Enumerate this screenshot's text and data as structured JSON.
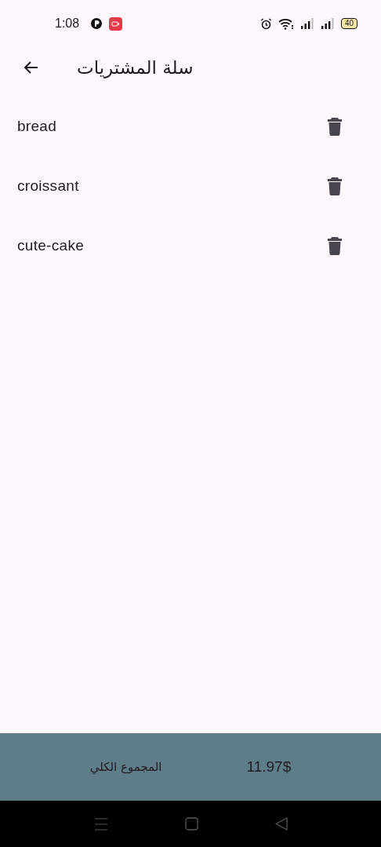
{
  "status_bar": {
    "time": "1:08",
    "battery": "40"
  },
  "app_bar": {
    "title": "سلة المشتريات"
  },
  "items": [
    {
      "name": "bread"
    },
    {
      "name": "croissant"
    },
    {
      "name": "cute-cake"
    }
  ],
  "total": {
    "label": "المجموع الكلي",
    "amount": "11.97$"
  }
}
